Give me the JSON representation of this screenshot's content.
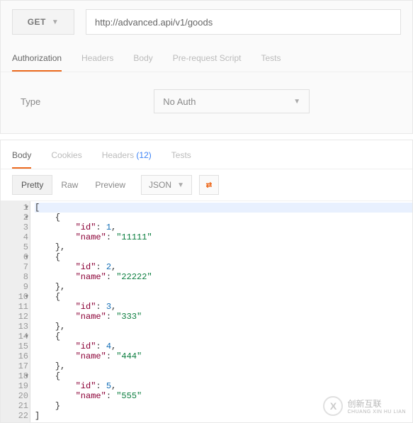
{
  "request": {
    "method": "GET",
    "url": "http://advanced.api/v1/goods"
  },
  "request_tabs": {
    "items": [
      {
        "label": "Authorization",
        "active": true
      },
      {
        "label": "Headers",
        "active": false
      },
      {
        "label": "Body",
        "active": false
      },
      {
        "label": "Pre-request Script",
        "active": false
      },
      {
        "label": "Tests",
        "active": false
      }
    ]
  },
  "auth": {
    "type_label": "Type",
    "selected": "No Auth"
  },
  "response_tabs": {
    "items": [
      {
        "label": "Body",
        "active": true,
        "count": ""
      },
      {
        "label": "Cookies",
        "active": false,
        "count": ""
      },
      {
        "label": "Headers",
        "active": false,
        "count": "(12)"
      },
      {
        "label": "Tests",
        "active": false,
        "count": ""
      }
    ]
  },
  "viewer": {
    "modes": [
      {
        "label": "Pretty",
        "active": true
      },
      {
        "label": "Raw",
        "active": false
      },
      {
        "label": "Preview",
        "active": false
      }
    ],
    "format": "JSON"
  },
  "response_body": {
    "lines": [
      {
        "n": 1,
        "fold": true,
        "indent": 0,
        "content": [
          {
            "t": "punc",
            "v": "["
          }
        ],
        "hl": true
      },
      {
        "n": 2,
        "fold": true,
        "indent": 1,
        "content": [
          {
            "t": "punc",
            "v": "{"
          }
        ]
      },
      {
        "n": 3,
        "fold": false,
        "indent": 2,
        "content": [
          {
            "t": "key",
            "v": "\"id\""
          },
          {
            "t": "punc",
            "v": ": "
          },
          {
            "t": "num",
            "v": "1"
          },
          {
            "t": "punc",
            "v": ","
          }
        ]
      },
      {
        "n": 4,
        "fold": false,
        "indent": 2,
        "content": [
          {
            "t": "key",
            "v": "\"name\""
          },
          {
            "t": "punc",
            "v": ": "
          },
          {
            "t": "str",
            "v": "\"11111\""
          }
        ]
      },
      {
        "n": 5,
        "fold": false,
        "indent": 1,
        "content": [
          {
            "t": "punc",
            "v": "},"
          }
        ]
      },
      {
        "n": 6,
        "fold": true,
        "indent": 1,
        "content": [
          {
            "t": "punc",
            "v": "{"
          }
        ]
      },
      {
        "n": 7,
        "fold": false,
        "indent": 2,
        "content": [
          {
            "t": "key",
            "v": "\"id\""
          },
          {
            "t": "punc",
            "v": ": "
          },
          {
            "t": "num",
            "v": "2"
          },
          {
            "t": "punc",
            "v": ","
          }
        ]
      },
      {
        "n": 8,
        "fold": false,
        "indent": 2,
        "content": [
          {
            "t": "key",
            "v": "\"name\""
          },
          {
            "t": "punc",
            "v": ": "
          },
          {
            "t": "str",
            "v": "\"22222\""
          }
        ]
      },
      {
        "n": 9,
        "fold": false,
        "indent": 1,
        "content": [
          {
            "t": "punc",
            "v": "},"
          }
        ]
      },
      {
        "n": 10,
        "fold": true,
        "indent": 1,
        "content": [
          {
            "t": "punc",
            "v": "{"
          }
        ]
      },
      {
        "n": 11,
        "fold": false,
        "indent": 2,
        "content": [
          {
            "t": "key",
            "v": "\"id\""
          },
          {
            "t": "punc",
            "v": ": "
          },
          {
            "t": "num",
            "v": "3"
          },
          {
            "t": "punc",
            "v": ","
          }
        ]
      },
      {
        "n": 12,
        "fold": false,
        "indent": 2,
        "content": [
          {
            "t": "key",
            "v": "\"name\""
          },
          {
            "t": "punc",
            "v": ": "
          },
          {
            "t": "str",
            "v": "\"333\""
          }
        ]
      },
      {
        "n": 13,
        "fold": false,
        "indent": 1,
        "content": [
          {
            "t": "punc",
            "v": "},"
          }
        ]
      },
      {
        "n": 14,
        "fold": true,
        "indent": 1,
        "content": [
          {
            "t": "punc",
            "v": "{"
          }
        ]
      },
      {
        "n": 15,
        "fold": false,
        "indent": 2,
        "content": [
          {
            "t": "key",
            "v": "\"id\""
          },
          {
            "t": "punc",
            "v": ": "
          },
          {
            "t": "num",
            "v": "4"
          },
          {
            "t": "punc",
            "v": ","
          }
        ]
      },
      {
        "n": 16,
        "fold": false,
        "indent": 2,
        "content": [
          {
            "t": "key",
            "v": "\"name\""
          },
          {
            "t": "punc",
            "v": ": "
          },
          {
            "t": "str",
            "v": "\"444\""
          }
        ]
      },
      {
        "n": 17,
        "fold": false,
        "indent": 1,
        "content": [
          {
            "t": "punc",
            "v": "},"
          }
        ]
      },
      {
        "n": 18,
        "fold": true,
        "indent": 1,
        "content": [
          {
            "t": "punc",
            "v": "{"
          }
        ]
      },
      {
        "n": 19,
        "fold": false,
        "indent": 2,
        "content": [
          {
            "t": "key",
            "v": "\"id\""
          },
          {
            "t": "punc",
            "v": ": "
          },
          {
            "t": "num",
            "v": "5"
          },
          {
            "t": "punc",
            "v": ","
          }
        ]
      },
      {
        "n": 20,
        "fold": false,
        "indent": 2,
        "content": [
          {
            "t": "key",
            "v": "\"name\""
          },
          {
            "t": "punc",
            "v": ": "
          },
          {
            "t": "str",
            "v": "\"555\""
          }
        ]
      },
      {
        "n": 21,
        "fold": false,
        "indent": 1,
        "content": [
          {
            "t": "punc",
            "v": "}"
          }
        ]
      },
      {
        "n": 22,
        "fold": false,
        "indent": 0,
        "content": [
          {
            "t": "punc",
            "v": "]"
          }
        ]
      }
    ]
  },
  "watermark": {
    "text_cn": "创新互联",
    "text_en": "CHUANG XIN HU LIAN"
  }
}
